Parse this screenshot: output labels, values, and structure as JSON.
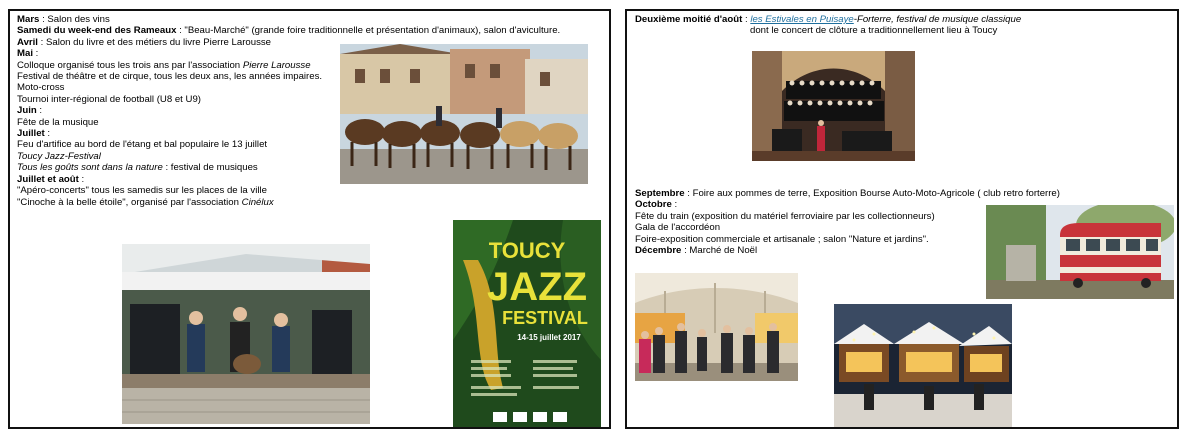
{
  "left_page": {
    "lines": [
      {
        "bold": "Mars",
        "rest": " : Salon des vins"
      },
      {
        "bold": "Samedi du week-end des Rameaux",
        "rest": " : \"Beau-Marché\" (grande foire traditionnelle et présentation d'animaux), salon d'aviculture."
      },
      {
        "bold": "Avril",
        "rest": " : Salon du livre et des métiers du livre Pierre Larousse"
      },
      {
        "bold": "Mai",
        "rest": " :"
      },
      {
        "pre": "Colloque organisé tous les trois ans par l'association ",
        "ital": "Pierre Larousse"
      },
      {
        "plain": "Festival de théâtre et de cirque, tous les deux ans, les années impaires."
      },
      {
        "plain": "Moto-cross"
      },
      {
        "plain": "Tournoi inter-régional de football (U8 et U9)"
      },
      {
        "bold": "Juin",
        "rest": " :"
      },
      {
        "plain": "Fête de la musique"
      },
      {
        "bold": "Juillet",
        "rest": " :"
      },
      {
        "plain": "Feu d'artifice au bord de l'étang et bal populaire le 13 juillet"
      },
      {
        "ital": "Toucy Jazz-Festival"
      },
      {
        "ital2": "Tous les goûts sont dans la nature",
        "rest": " : festival de musiques"
      },
      {
        "bold": "Juillet et août",
        "rest": " :"
      },
      {
        "plain": "\"Apéro-concerts\" tous les samedis sur les places de la ville"
      },
      {
        "pre": "\"Cinoche à la belle étoile\", organisé par l'association ",
        "ital": "Cinélux"
      }
    ],
    "poster": {
      "line1": "TOUCY",
      "line2": "JAZZ",
      "line3": "FESTIVAL",
      "dates": "14-15 juillet 2017"
    }
  },
  "right_page": {
    "august": {
      "bold": "Deuxième moitié d'août",
      "sep": " : ",
      "link_text": "les Estivales en Puisaye",
      "after": "-Forterre, festival de musique classique",
      "line2": "dont le concert de clôture a traditionnellement  lieu à Toucy"
    },
    "lines": [
      {
        "bold": "Septembre",
        "rest": " : Foire aux pommes de terre, Exposition Bourse Auto-Moto-Agricole ( club retro forterre)"
      },
      {
        "bold": "Octobre",
        "rest": " :"
      },
      {
        "plain": "Fête du train (exposition du matériel ferroviaire par les collectionneurs)"
      },
      {
        "plain": "Gala de l'accordéon"
      },
      {
        "plain": "Foire-exposition commerciale et artisanale ; salon \"Nature et jardins\"."
      },
      {
        "bold": "Décembre",
        "rest": " : Marché de Noël"
      }
    ]
  },
  "colors": {
    "poster_green": "#1f4a1c",
    "poster_yellow": "#e8e13a",
    "link": "#1f6f9e"
  },
  "icons": [
    "horse-fair-photo",
    "jazz-band-photo",
    "jazz-festival-poster",
    "orchestra-photo",
    "train-photo",
    "fair-hall-photo",
    "christmas-market-photo"
  ]
}
